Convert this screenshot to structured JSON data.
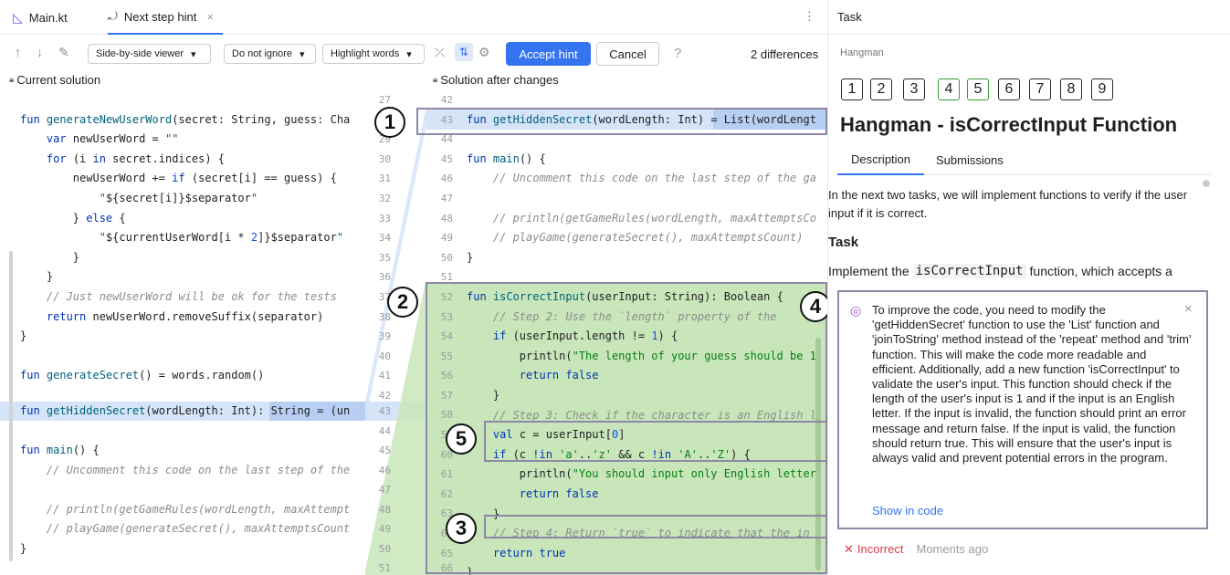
{
  "tabs": [
    {
      "label": "Main.kt"
    },
    {
      "label": "Next step hint"
    }
  ],
  "toolbar": {
    "viewer": "Side-by-side viewer",
    "ignore": "Do not ignore",
    "highlight": "Highlight words",
    "accept": "Accept hint",
    "cancel": "Cancel",
    "help": "?",
    "differences": "2 differences"
  },
  "left_panel": {
    "label": "Current solution"
  },
  "right_panel": {
    "label": "Solution after changes"
  },
  "left_code_numbers": [
    "27",
    "28",
    "29",
    "30",
    "31",
    "32",
    "33",
    "34",
    "35",
    "36",
    "37",
    "38",
    "39",
    "40",
    "41",
    "42",
    "43",
    "44",
    "45",
    "46",
    "47",
    "48",
    "49",
    "50",
    "51"
  ],
  "right_code_numbers": [
    "42",
    "43",
    "44",
    "45",
    "46",
    "47",
    "48",
    "49",
    "50",
    "51",
    "52",
    "53",
    "54",
    "55",
    "56",
    "57",
    "58",
    "59",
    "60",
    "61",
    "62",
    "63",
    "64",
    "65",
    "66"
  ],
  "badges": [
    "1",
    "2",
    "3",
    "4",
    "5"
  ],
  "side_panel": {
    "title": "Task",
    "course": "Hangman",
    "task_numbers": [
      "1",
      "2",
      "3",
      "4",
      "5",
      "6",
      "7",
      "8",
      "9"
    ],
    "heading": "Hangman - isCorrectInput Function",
    "tab_description": "Description",
    "tab_submissions": "Submissions",
    "description_1": "In the next two tasks, we will implement functions to verify if the user input if it is correct.",
    "subheading": "Task",
    "implement_prefix": "Implement the ",
    "implement_code": "isCorrectInput",
    "implement_suffix": " function, which accepts a",
    "hint_text": "To improve the code, you need to modify the 'getHiddenSecret' function to use the 'List' function and 'joinToString' method instead of the 'repeat' method and 'trim' function. This will make the code more readable and efficient. Additionally, add a new function 'isCorrectInput' to validate the user's input. This function should check if the length of the user's input is 1 and if the input is an English letter. If the input is invalid, the function should print an error message and return false. If the input is valid, the function should return true. This will ensure that the user's input is always valid and prevent potential errors in the program.",
    "show_in_code": "Show in code",
    "status": "Incorrect",
    "time": "Moments ago"
  },
  "colors": {
    "accent": "#3574f0",
    "added_bg": "#c8e6b9",
    "modified_bg": "#d6e4f8",
    "badge_border": "#8e87a8"
  }
}
